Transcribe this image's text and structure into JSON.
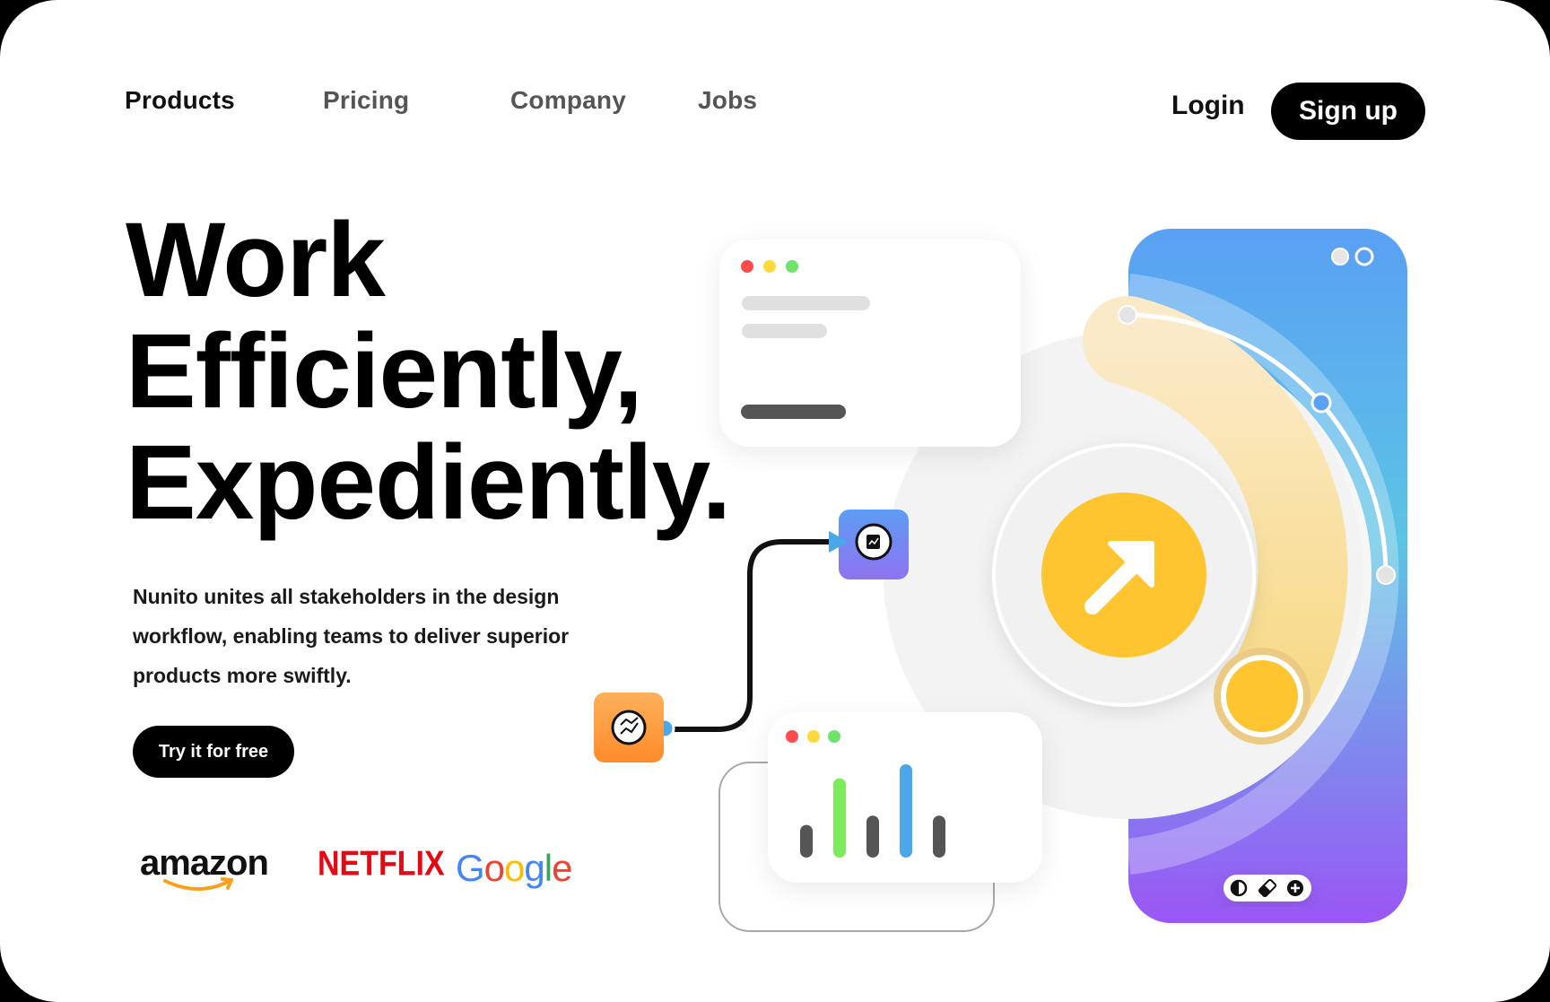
{
  "nav": {
    "items": [
      {
        "label": "Products"
      },
      {
        "label": "Pricing"
      },
      {
        "label": "Company"
      },
      {
        "label": "Jobs"
      }
    ],
    "login_label": "Login",
    "signup_label": "Sign up"
  },
  "hero": {
    "title_lines": [
      "Work",
      "Efficiently,",
      "Expediently."
    ],
    "description": "Nunito unites all stakeholders in the design workflow, enabling teams to deliver superior products more swiftly.",
    "cta_label": "Try it for free"
  },
  "logos": {
    "amazon": "amazon",
    "netflix": "NETFLIX",
    "google": "Google"
  },
  "illustration": {
    "chart_bar_values": [
      0.35,
      0.85,
      0.45,
      1.0,
      0.45
    ],
    "chart_bar_colors": [
      "#555555",
      "#7BEB5A",
      "#555555",
      "#4AA8E8",
      "#555555"
    ],
    "window_dots": [
      "#FF4B4B",
      "#FFD93B",
      "#6EE36A"
    ],
    "icons": [
      "trending-icon",
      "document-chart-icon",
      "arrow-up-right-icon",
      "contrast-icon",
      "eraser-icon",
      "plus-icon"
    ],
    "colors": {
      "accent_yellow": "#FFC531",
      "phone_gradient_top": "#5AA0F4",
      "phone_gradient_mid": "#5CC4E4",
      "phone_gradient_bottom": "#9B56F5",
      "orange_tile": "#FF9A3C",
      "purple_tile": "#7C7FF0"
    }
  }
}
